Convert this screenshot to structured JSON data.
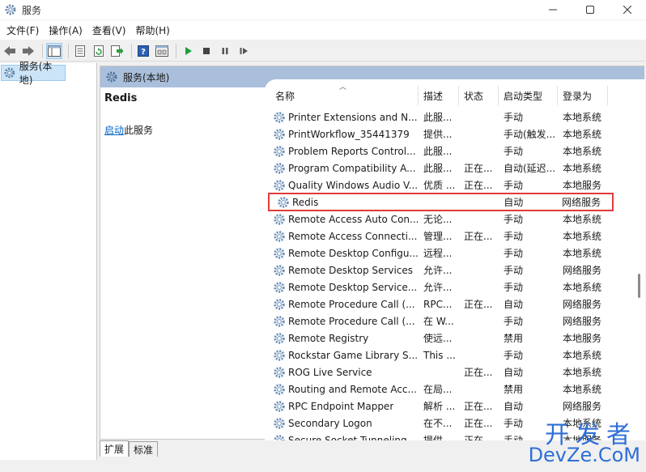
{
  "window": {
    "title": "服务",
    "controls": [
      "minimize-icon",
      "maximize-icon",
      "close-icon"
    ]
  },
  "menu": [
    "文件(F)",
    "操作(A)",
    "查看(V)",
    "帮助(H)"
  ],
  "toolbar": {
    "buttons": [
      "back-icon",
      "forward-icon",
      "show-tree-icon",
      "properties-icon",
      "refresh-icon",
      "export-icon",
      "help-icon",
      "view-icon",
      "play-icon",
      "stop-icon",
      "pause-icon",
      "resume-icon"
    ]
  },
  "tree": {
    "root_label": "服务(本地)"
  },
  "right_header": {
    "label": "服务(本地)"
  },
  "detail": {
    "service_name": "Redis",
    "start_link": "启动",
    "start_suffix": "此服务"
  },
  "columns": {
    "name": "名称",
    "description": "描述",
    "status": "状态",
    "startup_type": "启动类型",
    "logon_as": "登录为"
  },
  "services": [
    {
      "name": "Printer Extensions and N...",
      "description": "此服...",
      "status": "",
      "startup": "手动",
      "logon": "本地系统"
    },
    {
      "name": "PrintWorkflow_35441379",
      "description": "提供...",
      "status": "",
      "startup": "手动(触发...",
      "logon": "本地系统"
    },
    {
      "name": "Problem Reports Control...",
      "description": "此服...",
      "status": "",
      "startup": "手动",
      "logon": "本地系统"
    },
    {
      "name": "Program Compatibility A...",
      "description": "此服...",
      "status": "正在...",
      "startup": "自动(延迟...",
      "logon": "本地系统"
    },
    {
      "name": "Quality Windows Audio V...",
      "description": "优质 ...",
      "status": "正在...",
      "startup": "手动",
      "logon": "本地服务"
    },
    {
      "name": "Redis",
      "description": "",
      "status": "",
      "startup": "自动",
      "logon": "网络服务",
      "highlight": true
    },
    {
      "name": "Remote Access Auto Con...",
      "description": "无论...",
      "status": "",
      "startup": "手动",
      "logon": "本地系统"
    },
    {
      "name": "Remote Access Connecti...",
      "description": "管理...",
      "status": "正在...",
      "startup": "手动",
      "logon": "本地系统"
    },
    {
      "name": "Remote Desktop Configu...",
      "description": "远程...",
      "status": "",
      "startup": "手动",
      "logon": "本地系统"
    },
    {
      "name": "Remote Desktop Services",
      "description": "允许...",
      "status": "",
      "startup": "手动",
      "logon": "网络服务"
    },
    {
      "name": "Remote Desktop Service...",
      "description": "允许...",
      "status": "",
      "startup": "手动",
      "logon": "本地系统"
    },
    {
      "name": "Remote Procedure Call (...",
      "description": "RPC...",
      "status": "正在...",
      "startup": "自动",
      "logon": "网络服务"
    },
    {
      "name": "Remote Procedure Call (...",
      "description": "在 W...",
      "status": "",
      "startup": "手动",
      "logon": "网络服务"
    },
    {
      "name": "Remote Registry",
      "description": "使远...",
      "status": "",
      "startup": "禁用",
      "logon": "本地服务"
    },
    {
      "name": "Rockstar Game Library S...",
      "description": "This ...",
      "status": "",
      "startup": "手动",
      "logon": "本地系统"
    },
    {
      "name": "ROG Live Service",
      "description": "",
      "status": "正在...",
      "startup": "自动",
      "logon": "本地系统"
    },
    {
      "name": "Routing and Remote Acc...",
      "description": "在局...",
      "status": "",
      "startup": "禁用",
      "logon": "本地系统"
    },
    {
      "name": "RPC Endpoint Mapper",
      "description": "解析 ...",
      "status": "正在...",
      "startup": "自动",
      "logon": "网络服务"
    },
    {
      "name": "Secondary Logon",
      "description": "在不...",
      "status": "正在...",
      "startup": "手动",
      "logon": "本地系统"
    },
    {
      "name": "Secure Socket Tunneling",
      "description": "提供...",
      "status": "正在...",
      "startup": "手动",
      "logon": "本地服务"
    }
  ],
  "bottom_tabs": [
    "扩展",
    "标准"
  ],
  "watermark": {
    "cn": "开发者",
    "en": "DevZe.CoM"
  },
  "colors": {
    "header_bg": "#a9bfdb",
    "highlight_border": "#e23b3b",
    "link": "#0066cc",
    "selection": "#cce4f7"
  }
}
